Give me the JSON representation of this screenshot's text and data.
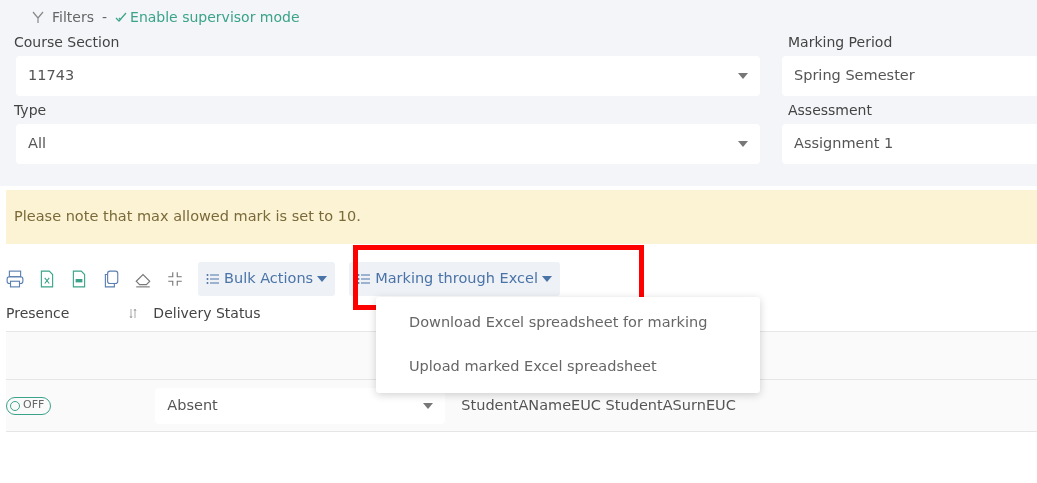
{
  "filters": {
    "title": "Filters",
    "separator": "-",
    "supervisor_link": "Enable supervisor mode",
    "fields": [
      {
        "label": "Course Section",
        "value": "11743"
      },
      {
        "label": "Marking Period",
        "value": "Spring Semester"
      },
      {
        "label": "Type",
        "value": "All"
      },
      {
        "label": "Assessment",
        "value": "Assignment 1"
      }
    ]
  },
  "notice": "Please note that max allowed mark is set to 10.",
  "toolbar": {
    "menus": [
      {
        "label": "Bulk Actions",
        "highlighted": false
      },
      {
        "label": "Marking through Excel",
        "highlighted": true,
        "expanded": true,
        "items": [
          "Download Excel spreadsheet for marking",
          "Upload marked Excel spreadsheet"
        ]
      }
    ]
  },
  "table": {
    "columns": [
      "Presence",
      "Delivery Status"
    ],
    "rows": [
      {
        "presence": {
          "on": false,
          "label": "OFF"
        },
        "delivery_status": "Absent",
        "student": "StudentANameEUC StudentASurnEUC"
      }
    ]
  }
}
